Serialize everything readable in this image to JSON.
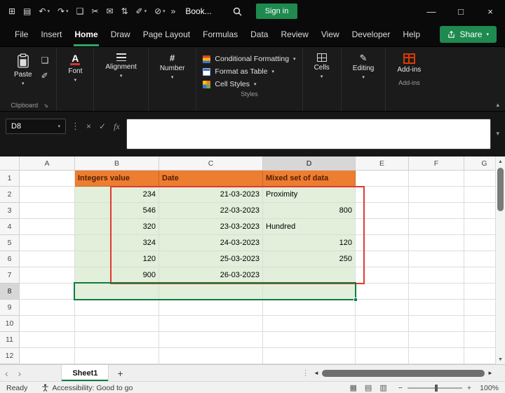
{
  "colors": {
    "accent_green": "#1E8A4F",
    "tab_underline_green": "#2FA564",
    "selection_green": "#107C41",
    "header_fill": "#ED7D31",
    "header_text": "#551E00",
    "data_fill": "#E2EFDA",
    "highlight_red": "#E03A2E"
  },
  "titlebar": {
    "doc_name": "Book...",
    "sign_in_label": "Sign in",
    "qat_icons": [
      {
        "name": "apps-icon",
        "glyph": "⊞",
        "dropdown": false
      },
      {
        "name": "save-icon",
        "glyph": "▤",
        "dropdown": false
      },
      {
        "name": "undo-icon",
        "glyph": "↶",
        "dropdown": true
      },
      {
        "name": "redo-icon",
        "glyph": "↷",
        "dropdown": true
      },
      {
        "name": "copy-icon",
        "glyph": "❏",
        "dropdown": false
      },
      {
        "name": "cut-icon",
        "glyph": "✂",
        "dropdown": false
      },
      {
        "name": "mail-icon",
        "glyph": "✉",
        "dropdown": false
      },
      {
        "name": "sort-icon",
        "glyph": "⇅",
        "dropdown": false
      },
      {
        "name": "format-painter-icon",
        "glyph": "✐",
        "dropdown": true
      },
      {
        "name": "clear-icon",
        "glyph": "⊘",
        "dropdown": true
      }
    ],
    "overflow_glyph": "»",
    "minimize_glyph": "—",
    "maximize_glyph": "□",
    "close_glyph": "×"
  },
  "ribbon": {
    "tabs": [
      "File",
      "Insert",
      "Home",
      "Draw",
      "Page Layout",
      "Formulas",
      "Data",
      "Review",
      "View",
      "Developer",
      "Help"
    ],
    "active_tab": "Home",
    "share_label": "Share",
    "paste_label": "Paste",
    "clipboard_group_label": "Clipboard",
    "font_label": "Font",
    "alignment_label": "Alignment",
    "number_label": "Number",
    "styles_items": [
      "Conditional Formatting",
      "Format as Table",
      "Cell Styles"
    ],
    "styles_group_label": "Styles",
    "cells_label": "Cells",
    "editing_label": "Editing",
    "addins_label": "Add-ins",
    "addins_group_label": "Add-ins"
  },
  "formula_bar": {
    "name_box_value": "D8",
    "cancel_glyph": "×",
    "enter_glyph": "✓",
    "fx_label": "fx",
    "formula_value": ""
  },
  "grid": {
    "column_headers": [
      "A",
      "B",
      "C",
      "D",
      "E",
      "F",
      "G"
    ],
    "row_headers": [
      "1",
      "2",
      "3",
      "4",
      "5",
      "6",
      "7",
      "8",
      "9",
      "10",
      "11",
      "12"
    ],
    "selected_column": "D",
    "selected_row": "8",
    "selected_range": "B8:D8",
    "table": {
      "columns": [
        "B",
        "C",
        "D"
      ],
      "headers": [
        "Integers value",
        "Date",
        "Mixed set of data"
      ],
      "rows": [
        [
          "234",
          "21-03-2023",
          "Proximity"
        ],
        [
          "546",
          "22-03-2023",
          "800"
        ],
        [
          "320",
          "23-03-2023",
          "Hundred"
        ],
        [
          "324",
          "24-03-2023",
          "120"
        ],
        [
          "120",
          "25-03-2023",
          "250"
        ],
        [
          "900",
          "26-03-2023",
          ""
        ]
      ]
    }
  },
  "sheet_bar": {
    "prev_glyph": "‹",
    "next_glyph": "›",
    "tabs": [
      "Sheet1"
    ],
    "active_tab": "Sheet1",
    "add_sheet_glyph": "+"
  },
  "status_bar": {
    "mode": "Ready",
    "accessibility_label": "Accessibility: Good to go",
    "view_icons": [
      {
        "name": "normal-view-icon",
        "glyph": "▦"
      },
      {
        "name": "page-layout-view-icon",
        "glyph": "▤"
      },
      {
        "name": "page-break-view-icon",
        "glyph": "▥"
      }
    ],
    "zoom_out_glyph": "−",
    "zoom_in_glyph": "+",
    "zoom_level": "100%"
  }
}
